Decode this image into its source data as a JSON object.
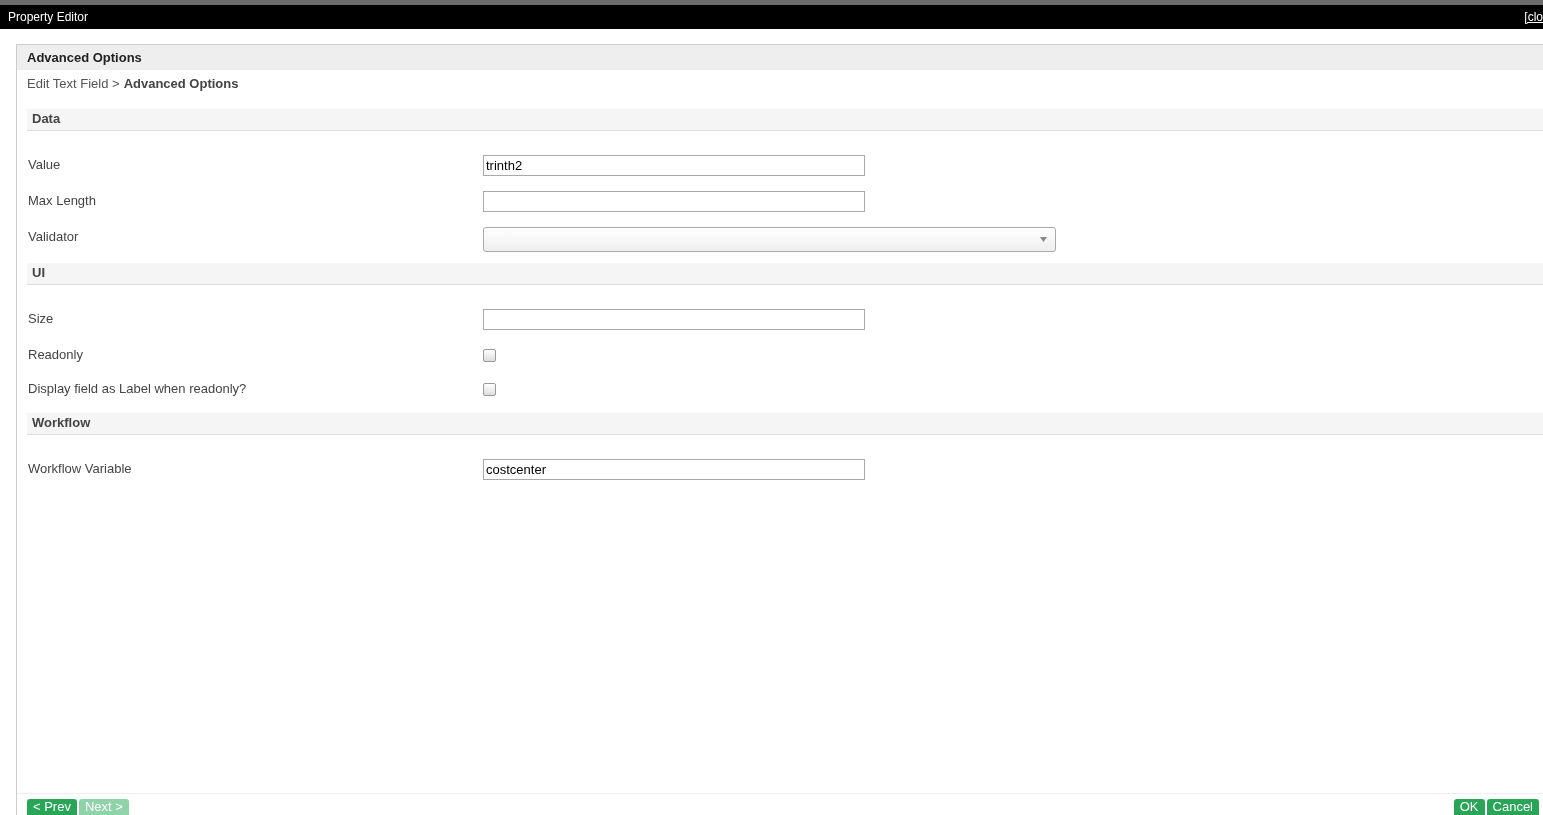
{
  "window": {
    "title": "Property Editor",
    "close_link": "[clo"
  },
  "page": {
    "title": "Advanced Options",
    "breadcrumb": {
      "parent": "Edit Text Field >",
      "current": "Advanced Options"
    }
  },
  "sections": [
    {
      "title": "Data",
      "fields": [
        {
          "label": "Value",
          "kind": "text",
          "value": "trinth2"
        },
        {
          "label": "Max Length",
          "kind": "text"
        },
        {
          "label": "Validator",
          "kind": "select"
        }
      ]
    },
    {
      "title": "UI",
      "fields": [
        {
          "label": "Size",
          "kind": "text"
        },
        {
          "label": "Readonly",
          "kind": "checkbox",
          "checked": false
        },
        {
          "label": "Display field as Label when readonly?",
          "kind": "checkbox",
          "checked": false
        }
      ]
    },
    {
      "title": "Workflow",
      "fields": [
        {
          "label": "Workflow Variable",
          "kind": "text",
          "value": "costcenter"
        }
      ]
    }
  ],
  "footer": {
    "left_buttons": [
      {
        "label": "< Prev",
        "disabled": false
      },
      {
        "label": "Next >",
        "disabled": true
      }
    ],
    "right_buttons": [
      {
        "label": "OK",
        "disabled": false
      },
      {
        "label": "Cancel",
        "disabled": false
      }
    ]
  }
}
